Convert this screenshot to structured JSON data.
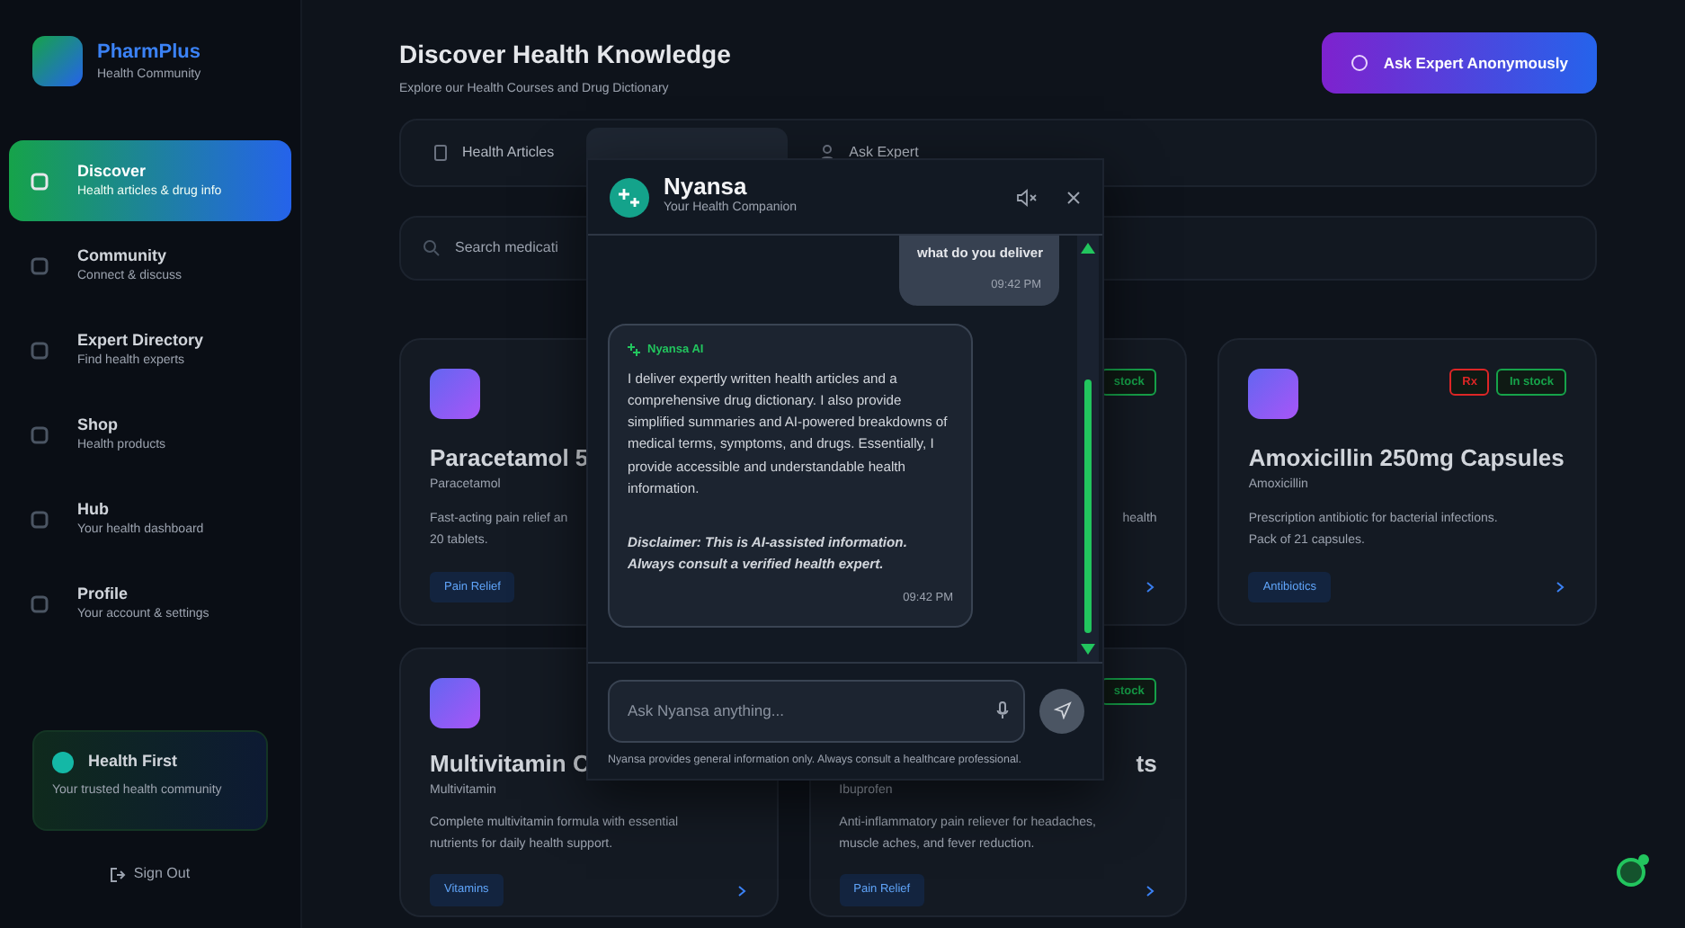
{
  "sidebar": {
    "brand": "PharmPlus",
    "tagline": "Health Community",
    "items": [
      {
        "label": "Discover",
        "hint": "Health articles & drug info",
        "selected": true
      },
      {
        "label": "Community",
        "hint": "Connect & discuss",
        "selected": false
      },
      {
        "label": "Expert Directory",
        "hint": "Find health experts",
        "selected": false
      },
      {
        "label": "Shop",
        "hint": "Health products",
        "selected": false
      },
      {
        "label": "Hub",
        "hint": "Your health dashboard",
        "selected": false
      },
      {
        "label": "Profile",
        "hint": "Your account & settings",
        "selected": false
      }
    ],
    "promo": {
      "title": "Health First",
      "text": "Your trusted health community"
    },
    "sign_out": "Sign Out"
  },
  "header": {
    "title": "Discover Health Knowledge",
    "subtitle": "Explore our Health Courses and Drug Dictionary",
    "action": "Ask Expert Anonymously"
  },
  "tabs": [
    {
      "label": "Health Articles",
      "selected": false
    },
    {
      "selected": true
    },
    {
      "label": "Ask Expert",
      "selected": false
    }
  ],
  "search": {
    "placeholder": "Search medicati"
  },
  "cards": [
    {
      "icon": true,
      "title": "Paracetamol 5",
      "subtitle": "Paracetamol",
      "description": [
        "Fast-acting pain relief an",
        "20 tablets."
      ],
      "tag": "Pain Relief",
      "arrow": false
    },
    {
      "icon": false,
      "badges": [
        {
          "text": "stock",
          "color": "#16a34a"
        }
      ],
      "description_end": "health",
      "arrow": true
    },
    {
      "icon": true,
      "badges": [
        {
          "text": "Rx",
          "color": "#dc2626"
        },
        {
          "text": "In stock",
          "color": "#16a34a"
        }
      ],
      "title": "Amoxicillin 250mg Capsules",
      "subtitle": "Amoxicillin",
      "description": [
        "Prescription antibiotic for bacterial infections.",
        "Pack of 21 capsules."
      ],
      "tag": "Antibiotics",
      "arrow": true
    },
    {
      "icon": true,
      "title": "Multivitamin C",
      "subtitle": "Multivitamin",
      "description": [
        "Complete multivitamin formula with essential",
        "nutrients for daily health support."
      ],
      "tag": "Vitamins",
      "arrow": true
    },
    {
      "icon": false,
      "badges": [
        {
          "text": "stock",
          "color": "#16a34a"
        }
      ],
      "title_end": "ts",
      "subtitle": "Ibuprofen",
      "description": [
        "Anti-inflammatory pain reliever for headaches,",
        "muscle aches, and fever reduction."
      ],
      "tag": "Pain Relief",
      "arrow": true
    }
  ],
  "chat": {
    "title": "Nyansa",
    "subtitle": "Your Health Companion",
    "messages": [
      {
        "kind": "user",
        "text": "what do you deliver",
        "time": "09:42 PM"
      },
      {
        "kind": "assistant",
        "sender": "Nyansa AI",
        "text": "I deliver expertly written health articles and a comprehensive drug dictionary. I also provide simplified summaries and AI-powered breakdowns of medical terms, symptoms, and drugs. Essentially, I provide accessible and understandable health information.",
        "disclaimer": "Disclaimer: This is AI-assisted information. Always consult a verified health expert.",
        "time": "09:42 PM"
      }
    ],
    "input": {
      "placeholder": "Ask Nyansa anything..."
    },
    "footer": "Nyansa provides general information only. Always consult a healthcare professional."
  }
}
